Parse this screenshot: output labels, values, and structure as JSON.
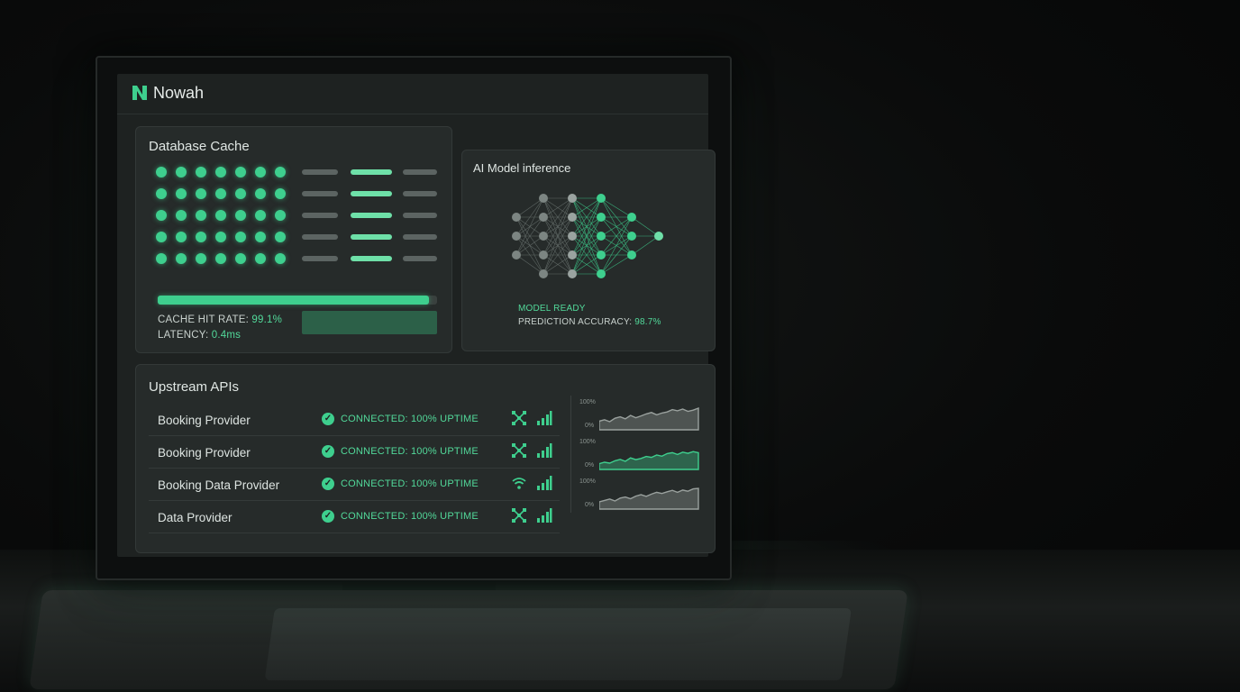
{
  "app": {
    "name": "Nowah"
  },
  "cache": {
    "title": "Database Cache",
    "hit_rate_label": "CACHE HIT RATE:",
    "hit_rate_value": "99.1%",
    "hit_rate_fraction": 0.97,
    "latency_label": "LATENCY:",
    "latency_value": "0.4ms"
  },
  "ai": {
    "title": "AI Model inference",
    "status": "MODEL READY",
    "accuracy_label": "PREDICTION ACCURACY:",
    "accuracy_value": "98.7%"
  },
  "upstream": {
    "title": "Upstream APIs",
    "rows": [
      {
        "name": "Booking Provider",
        "status": "CONNECTED: 100% UPTIME",
        "icon": "network-nodes-icon",
        "signal": "signal-bars-icon"
      },
      {
        "name": "Booking Provider",
        "status": "CONNECTED: 100% UPTIME",
        "icon": "network-nodes-icon",
        "signal": "signal-bars-icon"
      },
      {
        "name": "Booking Data Provider",
        "status": "CONNECTED: 100% UPTIME",
        "icon": "wifi-icon",
        "signal": "signal-bars-icon"
      },
      {
        "name": "Data Provider",
        "status": "CONNECTED: 100% UPTIME",
        "icon": "network-nodes-icon",
        "signal": "signal-bars-icon"
      }
    ],
    "sparklines": [
      {
        "top_label": "100%",
        "bottom_label": "0%",
        "color": "#9aa19e",
        "values": [
          30,
          35,
          28,
          40,
          45,
          38,
          50,
          42,
          48,
          55,
          60,
          52,
          58,
          62,
          70,
          66,
          72,
          64,
          68,
          75
        ]
      },
      {
        "top_label": "100%",
        "bottom_label": "0%",
        "color": "#3ecf8e",
        "values": [
          20,
          25,
          22,
          30,
          35,
          28,
          40,
          34,
          38,
          45,
          42,
          50,
          46,
          55,
          58,
          52,
          60,
          56,
          62,
          58
        ]
      },
      {
        "top_label": "100%",
        "bottom_label": "0%",
        "color": "#9aa19e",
        "values": [
          25,
          30,
          35,
          28,
          38,
          42,
          36,
          45,
          50,
          44,
          52,
          58,
          54,
          60,
          65,
          58,
          66,
          62,
          70,
          72
        ]
      }
    ]
  },
  "colors": {
    "accent": "#3ecf8e",
    "panel": "#262b2a",
    "screen": "#1e2221"
  }
}
